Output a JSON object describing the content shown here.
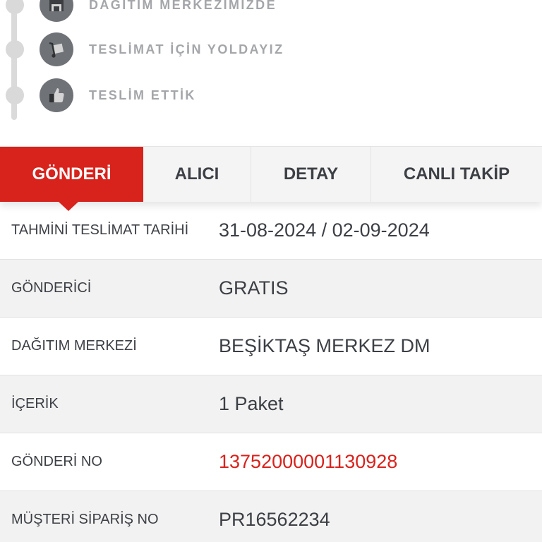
{
  "timeline": {
    "steps": [
      {
        "label": "DAĞITIM MERKEZİMİZDE",
        "icon": "warehouse-icon"
      },
      {
        "label": "TESLİMAT İÇİN YOLDAYIZ",
        "icon": "hand-truck-icon"
      },
      {
        "label": "TESLİM ETTİK",
        "icon": "thumbs-up-icon"
      }
    ]
  },
  "tabs": [
    {
      "label": "GÖNDERİ",
      "active": true
    },
    {
      "label": "ALICI",
      "active": false
    },
    {
      "label": "DETAY",
      "active": false
    },
    {
      "label": "CANLI TAKİP",
      "active": false
    }
  ],
  "details": [
    {
      "label": "TAHMİNİ TESLİMAT TARİHİ",
      "value": "31-08-2024 / 02-09-2024"
    },
    {
      "label": "GÖNDERİCİ",
      "value": "GRATIS"
    },
    {
      "label": "DAĞITIM MERKEZİ",
      "value": "BEŞİKTAŞ MERKEZ DM"
    },
    {
      "label": "İÇERİK",
      "value": "1 Paket"
    },
    {
      "label": "GÖNDERİ NO",
      "value": "13752000001130928"
    },
    {
      "label": "MÜŞTERİ SİPARİŞ NO",
      "value": "PR16562234"
    }
  ],
  "colors": {
    "accent": "#d8221c",
    "text": "#3c3f44",
    "muted": "#a4a6a9",
    "icon_bg": "#6f7277"
  }
}
